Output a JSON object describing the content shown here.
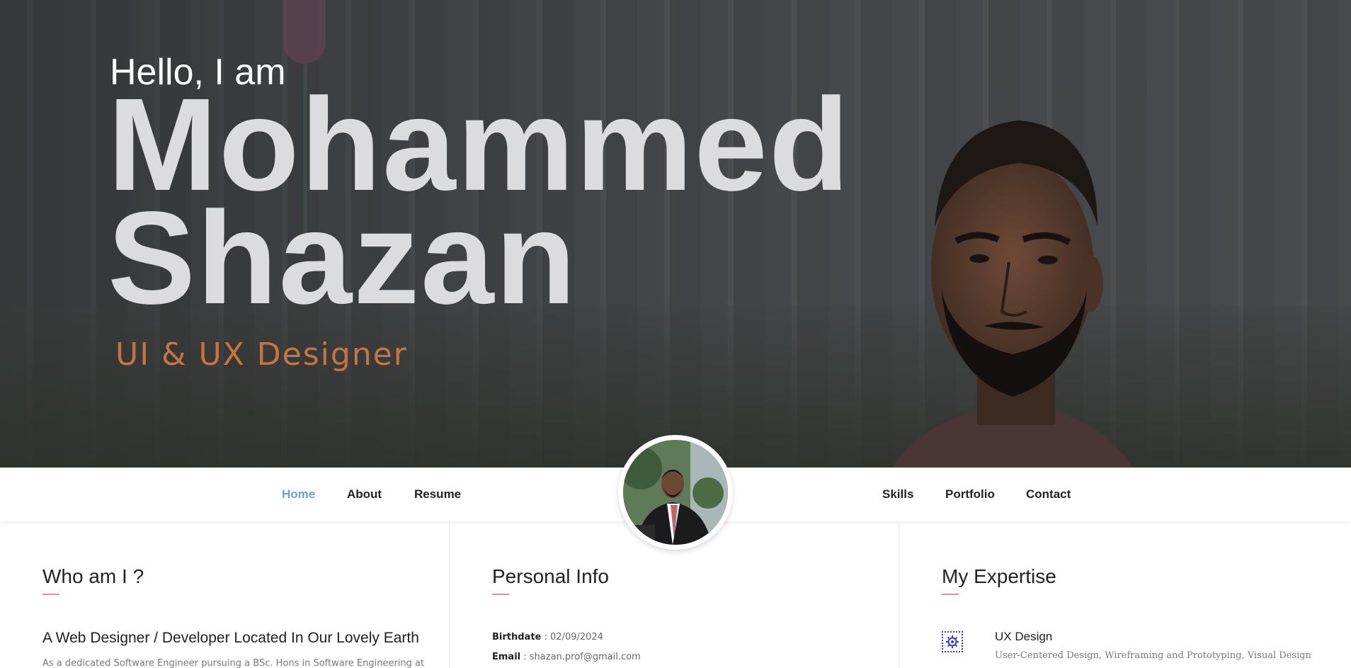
{
  "hero": {
    "greeting": "Hello, I am",
    "first_name": "Mohammed",
    "last_name": "Shazan",
    "role": "UI & UX Designer",
    "role_color": "#c8743f"
  },
  "nav": {
    "left": [
      {
        "label": "Home",
        "active": true
      },
      {
        "label": "About"
      },
      {
        "label": "Resume"
      }
    ],
    "right": [
      {
        "label": "Skills"
      },
      {
        "label": "Portfolio"
      },
      {
        "label": "Contact"
      }
    ],
    "active_color": "#6f9fd8"
  },
  "who": {
    "heading": "Who am I ?",
    "subheading": "A Web Designer / Developer Located In Our Lovely Earth",
    "paragraph": "As a dedicated Software Engineer pursuing a BSc. Hons in Software Engineering at"
  },
  "personal": {
    "heading": "Personal Info",
    "rows": [
      {
        "label": "Birthdate",
        "value": "02/09/2024"
      },
      {
        "label": "Email",
        "value": "shazan.prof@gmail.com"
      }
    ]
  },
  "expertise": {
    "heading": "My Expertise",
    "items": [
      {
        "icon": "gear-icon",
        "title": "UX Design",
        "desc": "User-Centered Design, Wireframing and Prototyping, Visual Design"
      }
    ]
  },
  "accent_underline": "#e88aa0"
}
